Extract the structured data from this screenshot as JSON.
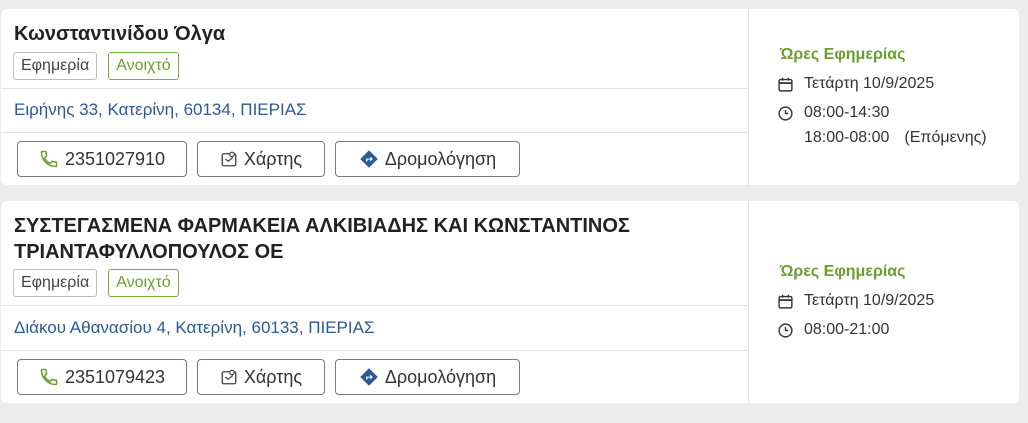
{
  "pharmacies": [
    {
      "name_lines": [
        "Κωνσταντινίδου Όλγα"
      ],
      "badge_duty": "Εφημερία",
      "badge_open": "Ανοιχτό",
      "address": "Ειρήνης 33, Κατερίνη, 60134, ΠΙΕΡΙΑΣ",
      "phone": "2351027910",
      "map_label": "Χάρτης",
      "route_label": "Δρομολόγηση",
      "hours_title": "Ώρες Εφημερίας",
      "date": "Τετάρτη 10/9/2025",
      "hours_1": "08:00-14:30",
      "hours_2": "18:00-08:00",
      "hours_2_note": "(Επόμενης)"
    },
    {
      "name_lines": [
        "ΣΥΣΤΕΓΑΣΜΕΝΑ ΦΑΡΜΑΚΕΙΑ ΑΛΚΙΒΙΑΔΗΣ ΚΑΙ ΚΩΝΣΤΑΝΤΙΝΟΣ",
        "ΤΡΙΑΝΤΑΦΥΛΛΟΠΟΥΛΟΣ ΟΕ"
      ],
      "badge_duty": "Εφημερία",
      "badge_open": "Ανοιχτό",
      "address": "Διάκου Αθανασίου 4, Κατερίνη, 60133, ΠΙΕΡΙΑΣ",
      "phone": "2351079423",
      "map_label": "Χάρτης",
      "route_label": "Δρομολόγηση",
      "hours_title": "Ώρες Εφημερίας",
      "date": "Τετάρτη 10/9/2025",
      "hours_1": "08:00-21:00"
    }
  ],
  "colors": {
    "accent_green": "#6a9e2f",
    "link_blue": "#2a5a96",
    "page_bg": "#ececec"
  },
  "icons": {
    "phone": "phone-icon",
    "map": "map-icon",
    "route": "route-diamond-icon",
    "calendar": "calendar-icon",
    "clock": "clock-icon"
  }
}
